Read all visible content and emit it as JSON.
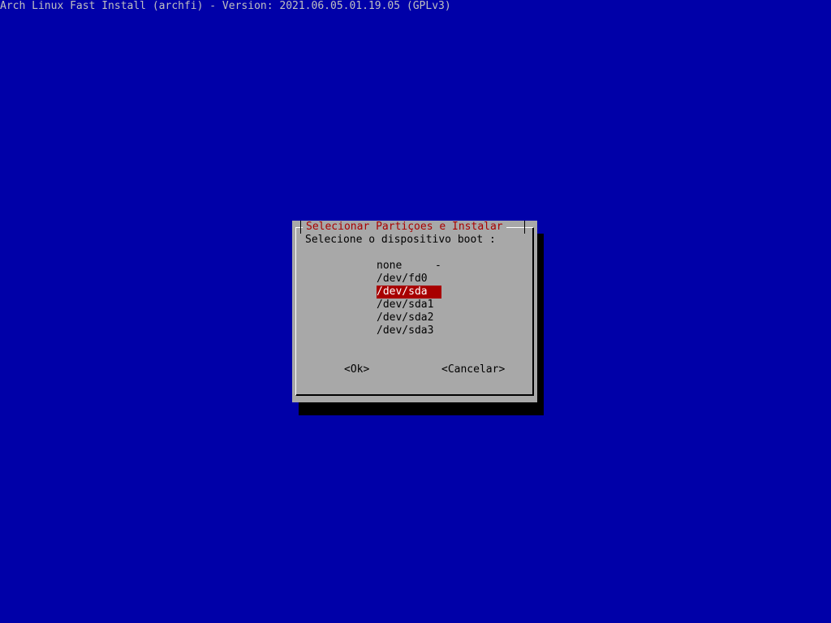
{
  "backtitle": "Arch Linux Fast Install (archfi) - Version: 2021.06.05.01.19.05 (GPLv3)",
  "dialog": {
    "title": "Selecionar Partiçoes e Instalar",
    "prompt": "Selecione o dispositivo boot :",
    "items": [
      {
        "tag": "none",
        "desc": "-"
      },
      {
        "tag": "/dev/fd0",
        "desc": ""
      },
      {
        "tag": "/dev/sda",
        "desc": ""
      },
      {
        "tag": "/dev/sda1",
        "desc": ""
      },
      {
        "tag": "/dev/sda2",
        "desc": ""
      },
      {
        "tag": "/dev/sda3",
        "desc": ""
      }
    ],
    "selected_index": 2,
    "ok_label": "<Ok>",
    "cancel_label": "<Cancelar>"
  },
  "colors": {
    "background": "#0000a8",
    "dialog": "#a8a8a8",
    "title": "#a80000",
    "selection": "#a80000"
  }
}
